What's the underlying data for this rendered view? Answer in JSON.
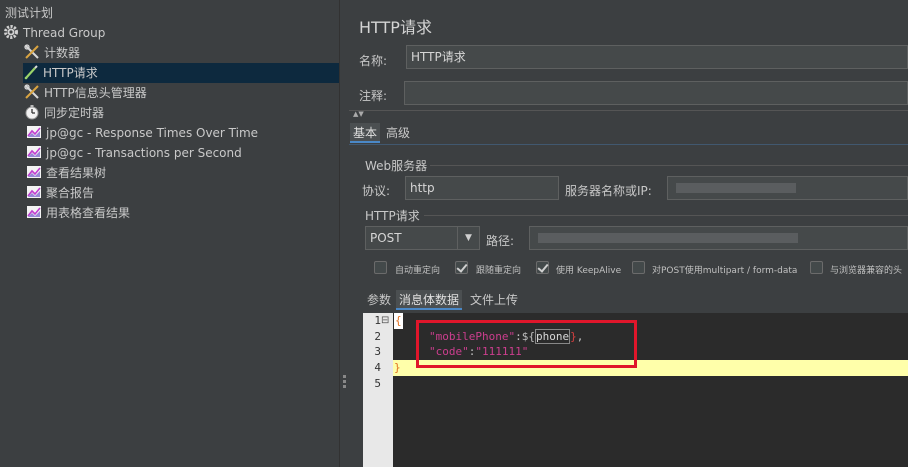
{
  "tree": {
    "root_label": "测试计划",
    "items": [
      {
        "label": "Thread Group",
        "icon": "gear-icon"
      },
      {
        "label": "计数器",
        "icon": "wrench-icon"
      },
      {
        "label": "HTTP请求",
        "icon": "pipette-icon",
        "selected": true
      },
      {
        "label": "HTTP信息头管理器",
        "icon": "wrench-icon"
      },
      {
        "label": "同步定时器",
        "icon": "timer-icon"
      },
      {
        "label": "jp@gc - Response Times Over Time",
        "icon": "graph-icon"
      },
      {
        "label": "jp@gc - Transactions per Second",
        "icon": "graph-icon"
      },
      {
        "label": "查看结果树",
        "icon": "graph-icon"
      },
      {
        "label": "聚合报告",
        "icon": "graph-icon"
      },
      {
        "label": "用表格查看结果",
        "icon": "graph-icon"
      }
    ]
  },
  "panel": {
    "title": "HTTP请求",
    "name_label": "名称:",
    "name_value": "HTTP请求",
    "comment_label": "注释:",
    "comment_value": "",
    "tabs": [
      "基本",
      "高级"
    ],
    "web_server_label": "Web服务器",
    "protocol_label": "协议:",
    "protocol_value": "http",
    "server_label": "服务器名称或IP:",
    "http_request_label": "HTTP请求",
    "method_value": "POST",
    "path_label": "路径:",
    "checkboxes": [
      {
        "label": "自动重定向",
        "checked": false
      },
      {
        "label": "跟随重定向",
        "checked": true
      },
      {
        "label": "使用 KeepAlive",
        "checked": true
      },
      {
        "label": "对POST使用multipart / form-data",
        "checked": false
      },
      {
        "label": "与浏览器兼容的头",
        "checked": false
      }
    ],
    "body_tabs": [
      "参数",
      "消息体数据",
      "文件上传"
    ],
    "active_body_tab": "消息体数据"
  },
  "editor": {
    "line_numbers": [
      "1",
      "2",
      "3",
      "4",
      "5"
    ],
    "line1": "{",
    "line2_key": "\"mobilePhone\"",
    "line2_colon": ":",
    "line2_var_open": "${",
    "line2_var_name": "phone",
    "line2_var_close": "}",
    "line2_comma": ",",
    "line3_key": "\"code\"",
    "line3_colon": ":",
    "line3_value": "\"111111\"",
    "line4": "}",
    "fold_marker": "⊟"
  },
  "colors": {
    "selection": "#0d293e",
    "key_pink": "#cc3e8e",
    "highlight_line": "#ffffaa",
    "annotation_red": "#e0162b"
  }
}
